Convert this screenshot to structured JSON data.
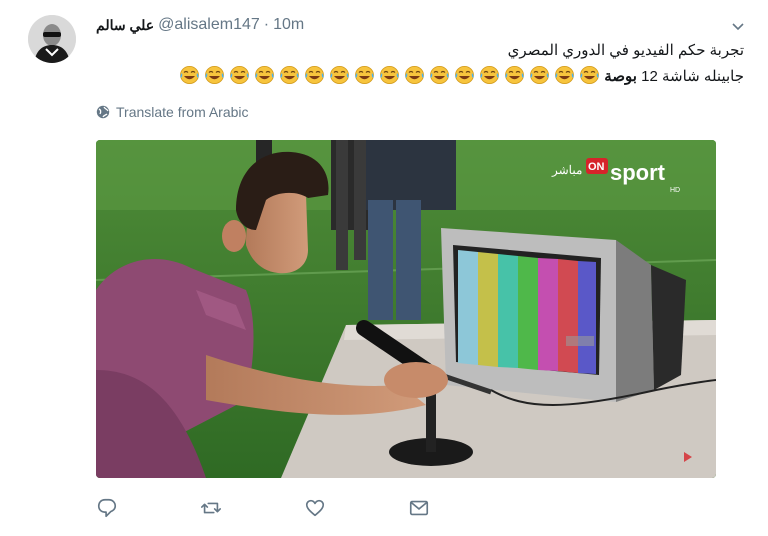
{
  "tweet": {
    "display_name": "علي سالم",
    "handle": "@alisalem147",
    "separator": "·",
    "time": "10m",
    "text_line1": "تجربة حكم الفيديو في الدوري المصري",
    "text_line2_prefix": "جابينله شاشة 12 ",
    "text_line2_bold": "بوصة",
    "emoji_icon": "face-with-tears-of-joy",
    "emoji_count_line2": 17,
    "translate_label": "Translate from Arabic"
  },
  "media": {
    "channel_logo": "ONsport",
    "channel_live": "مباشر",
    "channel_hd": "HD"
  },
  "actions": {
    "reply_icon": "reply-icon",
    "retweet_icon": "retweet-icon",
    "like_icon": "heart-icon",
    "dm_icon": "envelope-icon"
  },
  "colors": {
    "primary_text": "#14171a",
    "secondary_text": "#657786",
    "accent": "#1da1f2"
  }
}
